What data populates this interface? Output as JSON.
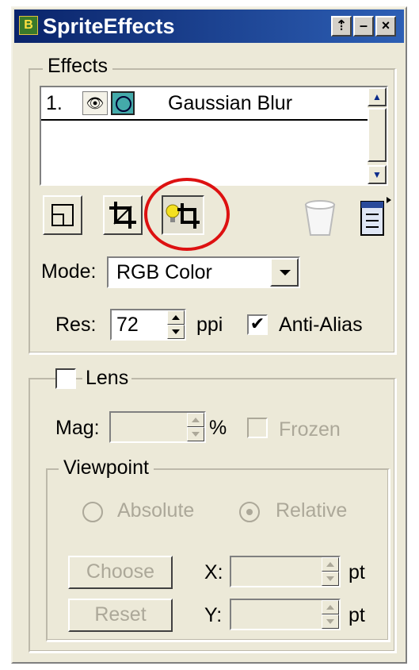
{
  "window": {
    "title": "SpriteEffects",
    "title_icon_text": "B",
    "buttons": {
      "pin": "⇡",
      "minimize": "–",
      "close": "×"
    }
  },
  "effects": {
    "legend": "Effects",
    "items": [
      {
        "index": "1.",
        "name": "Gaussian Blur",
        "visible_icon": "eye-icon",
        "effect_icon": "blur-effect-icon"
      }
    ],
    "tool_icons": [
      "transform-icon",
      "crop-icon",
      "lightbulb-crop-icon",
      "trash-icon",
      "menu-icon"
    ],
    "mode_label": "Mode:",
    "mode_value": "RGB Color",
    "res_label": "Res:",
    "res_value": "72",
    "res_unit": "ppi",
    "antialias_label": "Anti-Alias",
    "antialias_checked": "✔"
  },
  "lens": {
    "label": "Lens",
    "mag_label": "Mag:",
    "mag_value": "",
    "mag_unit": "%",
    "frozen_label": "Frozen",
    "viewpoint": {
      "legend": "Viewpoint",
      "absolute_label": "Absolute",
      "relative_label": "Relative",
      "choose_label": "Choose",
      "reset_label": "Reset",
      "x_label": "X:",
      "y_label": "Y:",
      "x_unit": "pt",
      "y_unit": "pt",
      "x_value": "",
      "y_value": ""
    }
  },
  "colors": {
    "highlight_circle": "#dd1111",
    "title_bar": "#0a246a",
    "panel": "#ece9d8"
  }
}
